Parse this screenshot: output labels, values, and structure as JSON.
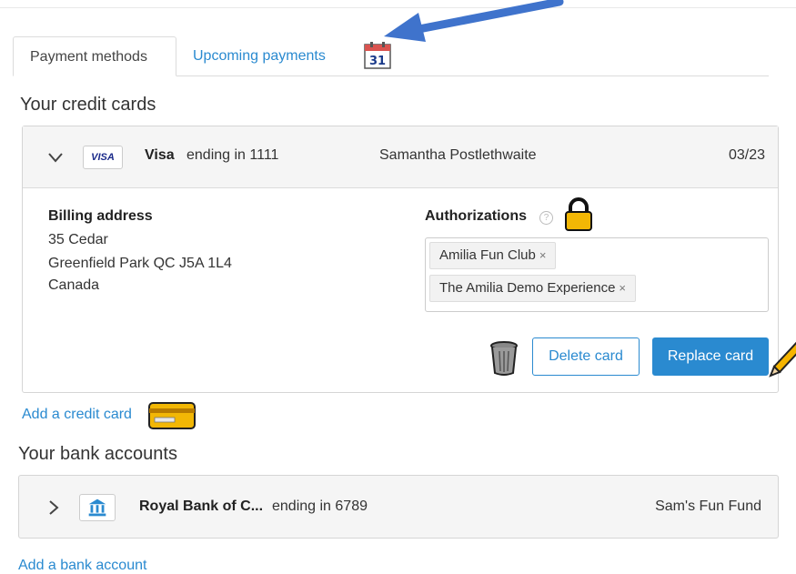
{
  "tabs": {
    "payment_methods": "Payment methods",
    "upcoming_payments": "Upcoming payments",
    "calendar_icon": "calendar-icon",
    "calendar_day": "31"
  },
  "credit_cards": {
    "title": "Your credit cards",
    "card": {
      "network_badge": "VISA",
      "brand": "Visa",
      "ending": "ending in 1111",
      "holder": "Samantha Postlethwaite",
      "expiry": "03/23",
      "billing_label": "Billing address",
      "address_lines": [
        "35 Cedar",
        "Greenfield Park QC J5A 1L4",
        "Canada"
      ],
      "authorizations_label": "Authorizations",
      "help_symbol": "?",
      "authorizations": [
        {
          "name": "Amilia Fun Club",
          "remove": "×"
        },
        {
          "name": "The Amilia Demo Experience",
          "remove": "×"
        }
      ],
      "delete_label": "Delete card",
      "replace_label": "Replace card"
    },
    "add_link": "Add a credit card"
  },
  "bank_accounts": {
    "title": "Your bank accounts",
    "account": {
      "name": "Royal Bank of C...",
      "ending": "ending in 6789",
      "owner": "Sam's Fun Fund"
    },
    "add_link": "Add a bank account"
  },
  "colors": {
    "accent": "#2a8ad0",
    "annotation_arrow": "#3f73cc"
  }
}
